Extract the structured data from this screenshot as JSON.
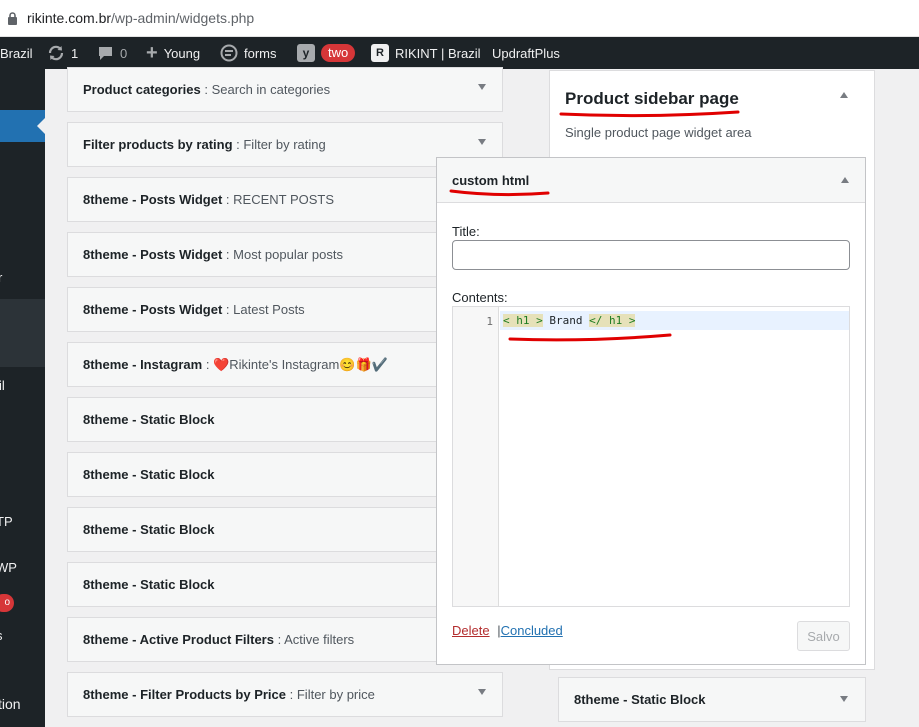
{
  "browser": {
    "url_domain": "rikinte.com.br",
    "url_path": "/wp-admin/widgets.php"
  },
  "admin_bar": {
    "site_name": "Brazil",
    "updates_count": "1",
    "comments_count": "0",
    "new_label": "Young",
    "forms_label": "forms",
    "yoast_badge": "two",
    "site_switch_label": "RIKINT | Brazil",
    "updraft_label": "UpdraftPlus"
  },
  "sidebar_menu": [
    "r",
    "il",
    "TP",
    "WP",
    "o",
    "s",
    "tion"
  ],
  "available_widgets": [
    {
      "name": "Product categories",
      "sep": " : ",
      "instance": "Search in categories",
      "caret": true
    },
    {
      "name": "Filter products by rating",
      "sep": " : ",
      "instance": "Filter by rating",
      "caret": true
    },
    {
      "name": "8theme - Posts Widget",
      "sep": " : ",
      "instance": "RECENT POSTS",
      "caret": false
    },
    {
      "name": "8theme - Posts Widget",
      "sep": " : ",
      "instance": "Most popular posts",
      "caret": false
    },
    {
      "name": "8theme - Posts Widget",
      "sep": " : ",
      "instance": "Latest Posts",
      "caret": false
    },
    {
      "name": "8theme - Instagram",
      "sep": " : ",
      "instance": "❤️Rikinte's Instagram😊🎁✔️",
      "caret": false
    },
    {
      "name": "8theme - Static Block",
      "sep": "",
      "instance": "",
      "caret": false
    },
    {
      "name": "8theme - Static Block",
      "sep": "",
      "instance": "",
      "caret": false
    },
    {
      "name": "8theme - Static Block",
      "sep": "",
      "instance": "",
      "caret": false
    },
    {
      "name": "8theme - Static Block",
      "sep": "",
      "instance": "",
      "caret": false
    },
    {
      "name": "8theme - Active Product Filters",
      "sep": " : ",
      "instance": "Active filters",
      "caret": false
    },
    {
      "name": "8theme - Filter Products by Price",
      "sep": " : ",
      "instance": "Filter by price",
      "caret": true
    }
  ],
  "widget_area": {
    "title": "Product sidebar page",
    "description": "Single product page widget area"
  },
  "edit_widget": {
    "title": "custom html",
    "title_label": "Title:",
    "title_value": "",
    "contents_label": "Contents:",
    "line_number": "1",
    "code_open_tag": "< h1 >",
    "code_text": " Brand ",
    "code_close_tag": "</ h1 >",
    "delete_label": "Delete",
    "separator": "|",
    "done_label": "Concluded",
    "save_label": "Salvo"
  },
  "area_next_widget": {
    "name": "8theme - Static Block"
  },
  "colors": {
    "admin_bar": "#1d2327",
    "accent": "#2271b1",
    "badge": "#d63638",
    "annotation": "#e00000"
  }
}
